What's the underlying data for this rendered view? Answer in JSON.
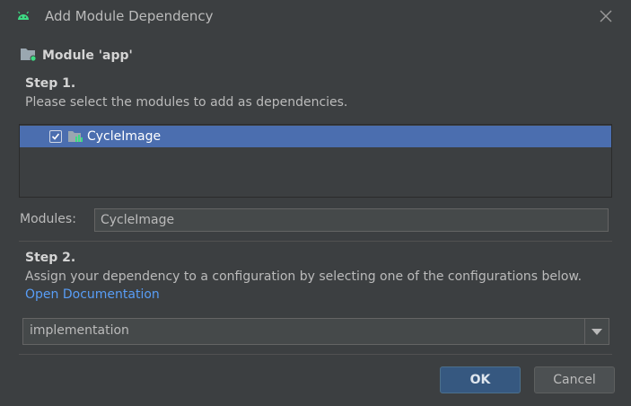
{
  "window": {
    "title": "Add Module Dependency",
    "icon": "android-icon",
    "close_icon": "close-icon"
  },
  "module_header": {
    "label": "Module 'app'",
    "icon": "module-folder-icon"
  },
  "step1": {
    "title": "Step 1.",
    "description": "Please select the modules to add as dependencies.",
    "modules": [
      {
        "label": "CycleImage",
        "checked": true,
        "selected": true,
        "icon": "module-library-icon"
      }
    ]
  },
  "modules_field": {
    "label": "Modules:",
    "value": "CycleImage"
  },
  "step2": {
    "title": "Step 2.",
    "description": "Assign your dependency to a configuration by selecting one of the configurations below.",
    "link": "Open Documentation",
    "configuration": "implementation"
  },
  "buttons": {
    "ok": "OK",
    "cancel": "Cancel"
  },
  "colors": {
    "background": "#3c3f41",
    "selection": "#4b6eaf",
    "link": "#589df6",
    "primary_button": "#365880",
    "android_green": "#3ddc84"
  }
}
